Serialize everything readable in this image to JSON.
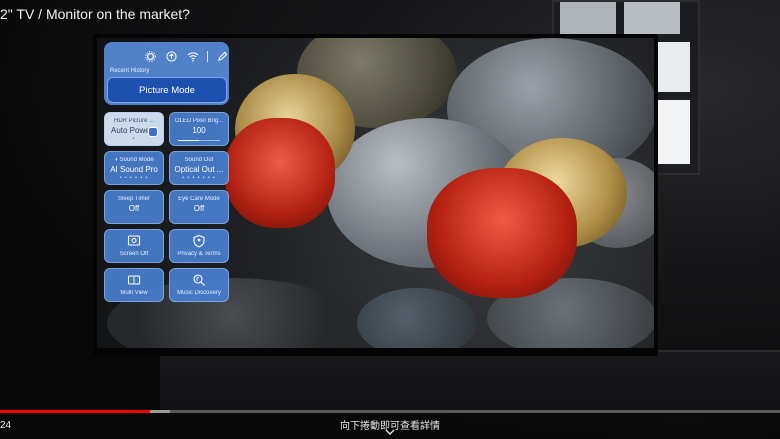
{
  "video": {
    "title": "2\" TV / Monitor on the market?",
    "time": "24",
    "hint": "向下捲動即可查看詳情",
    "progress_colors": {
      "played": "#ff0000",
      "buffered": "#9a9a9a",
      "track": "#5a5a5a"
    }
  },
  "quick_menu": {
    "header_icons": [
      "gear-icon",
      "upload-icon",
      "wifi-icon",
      "edit-icon"
    ],
    "recent_label": "Recent History",
    "picture_mode": "Picture Mode",
    "tiles": [
      {
        "id": "hdr",
        "label": "HDR Picture ...",
        "value": "Auto Power"
      },
      {
        "id": "oled",
        "label": "OLED Pixel Brig...",
        "value": "100",
        "level": 0.5
      },
      {
        "id": "sound-mode",
        "label": "Sound Mode",
        "value": "AI Sound Pro"
      },
      {
        "id": "sound-out",
        "label": "Sound Out",
        "value": "Optical Out ..."
      },
      {
        "id": "sleep",
        "label": "Sleep Timer",
        "value": "Off"
      },
      {
        "id": "eye-care",
        "label": "Eye Care Mode",
        "value": "Off"
      },
      {
        "id": "screen-off",
        "label": "Screen Off",
        "icon": "screen-off-icon"
      },
      {
        "id": "privacy",
        "label": "Privacy & Terms",
        "icon": "privacy-shield-icon"
      },
      {
        "id": "multi-view",
        "label": "Multi View",
        "icon": "multi-view-icon"
      },
      {
        "id": "music",
        "label": "Music Discovery",
        "icon": "music-discovery-icon"
      }
    ],
    "accent": "#1d4fae"
  }
}
